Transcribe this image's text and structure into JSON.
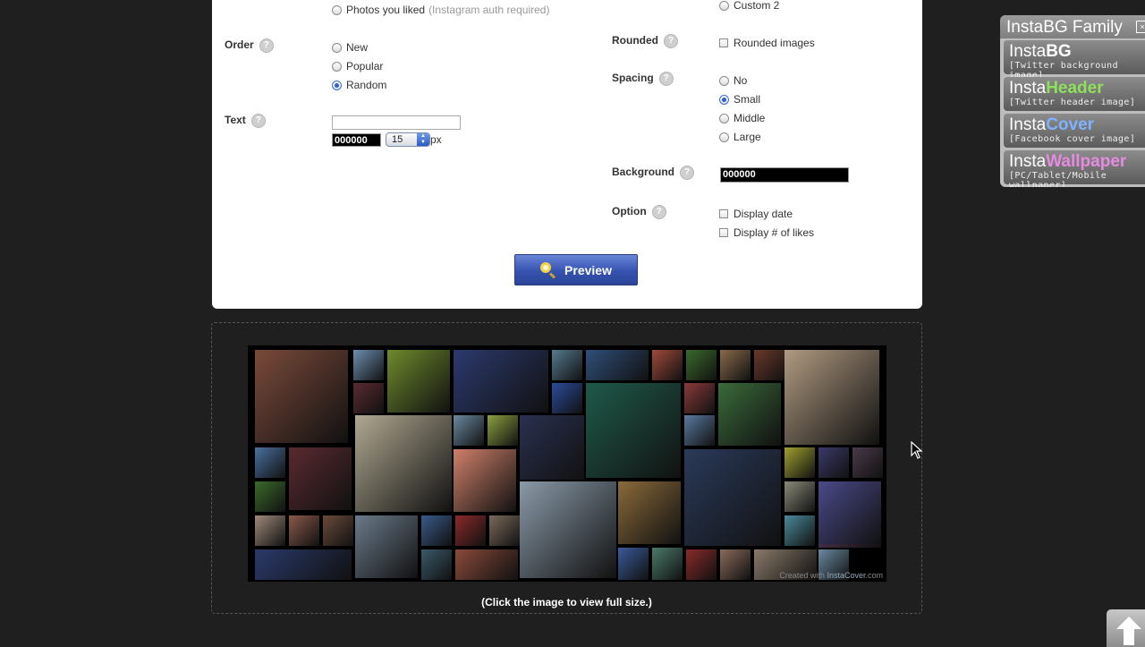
{
  "form": {
    "source_option": {
      "label": "Photos you liked",
      "note": "(Instagram auth required)"
    },
    "order": {
      "label": "Order",
      "options": [
        "New",
        "Popular",
        "Random"
      ],
      "selected": "Random"
    },
    "text": {
      "label": "Text",
      "value": "",
      "color": "000000",
      "size": "15",
      "unit": "px"
    },
    "custom_option": "Custom 2",
    "rounded": {
      "label": "Rounded",
      "option": "Rounded images"
    },
    "spacing": {
      "label": "Spacing",
      "options": [
        "No",
        "Small",
        "Middle",
        "Large"
      ],
      "selected": "Small"
    },
    "background": {
      "label": "Background",
      "value": "000000"
    },
    "option": {
      "label": "Option",
      "items": [
        "Display date",
        "Display # of likes"
      ]
    },
    "help_glyph": "?",
    "preview_label": "Preview"
  },
  "result": {
    "caption": "(Click the image to view full size.)",
    "credit_prefix": "Created with",
    "credit_brand": "Insta",
    "credit_brand2": "Cover",
    "credit_suffix": ".com"
  },
  "family": {
    "title": "InstaBG Family",
    "close_glyph": "×",
    "items": [
      {
        "prefix": "Insta",
        "accent": "BG",
        "sub": "[Twitter background image]",
        "accent_color": "#ffffff"
      },
      {
        "prefix": "Insta",
        "accent": "Header",
        "sub": "[Twitter header image]",
        "accent_color": "#8ee05a"
      },
      {
        "prefix": "Insta",
        "accent": "Cover",
        "sub": "[Facebook cover image]",
        "accent_color": "#7fb2ff"
      },
      {
        "prefix": "Insta",
        "accent": "Wallpaper",
        "sub": "[PC/Tablet/Mobile wallpaper]",
        "accent_color": "#e58be0"
      }
    ]
  },
  "colors": {
    "page_bg": "#1f1f1f",
    "panel_bg": "#ffffff",
    "preview_button": "#3552b0"
  },
  "icons": {
    "scroll_top": "up-arrow-icon",
    "preview": "magnifier-icon",
    "help": "question-mark-icon"
  }
}
